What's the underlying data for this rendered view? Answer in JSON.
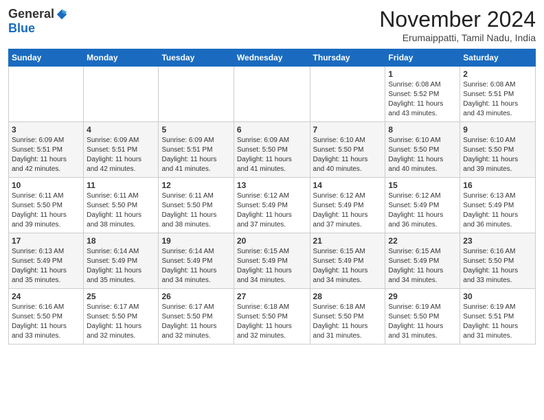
{
  "header": {
    "logo_general": "General",
    "logo_blue": "Blue",
    "month_title": "November 2024",
    "location": "Erumaippatti, Tamil Nadu, India"
  },
  "calendar": {
    "days_of_week": [
      "Sunday",
      "Monday",
      "Tuesday",
      "Wednesday",
      "Thursday",
      "Friday",
      "Saturday"
    ],
    "weeks": [
      [
        {
          "day": "",
          "info": ""
        },
        {
          "day": "",
          "info": ""
        },
        {
          "day": "",
          "info": ""
        },
        {
          "day": "",
          "info": ""
        },
        {
          "day": "",
          "info": ""
        },
        {
          "day": "1",
          "info": "Sunrise: 6:08 AM\nSunset: 5:52 PM\nDaylight: 11 hours\nand 43 minutes."
        },
        {
          "day": "2",
          "info": "Sunrise: 6:08 AM\nSunset: 5:51 PM\nDaylight: 11 hours\nand 43 minutes."
        }
      ],
      [
        {
          "day": "3",
          "info": "Sunrise: 6:09 AM\nSunset: 5:51 PM\nDaylight: 11 hours\nand 42 minutes."
        },
        {
          "day": "4",
          "info": "Sunrise: 6:09 AM\nSunset: 5:51 PM\nDaylight: 11 hours\nand 42 minutes."
        },
        {
          "day": "5",
          "info": "Sunrise: 6:09 AM\nSunset: 5:51 PM\nDaylight: 11 hours\nand 41 minutes."
        },
        {
          "day": "6",
          "info": "Sunrise: 6:09 AM\nSunset: 5:50 PM\nDaylight: 11 hours\nand 41 minutes."
        },
        {
          "day": "7",
          "info": "Sunrise: 6:10 AM\nSunset: 5:50 PM\nDaylight: 11 hours\nand 40 minutes."
        },
        {
          "day": "8",
          "info": "Sunrise: 6:10 AM\nSunset: 5:50 PM\nDaylight: 11 hours\nand 40 minutes."
        },
        {
          "day": "9",
          "info": "Sunrise: 6:10 AM\nSunset: 5:50 PM\nDaylight: 11 hours\nand 39 minutes."
        }
      ],
      [
        {
          "day": "10",
          "info": "Sunrise: 6:11 AM\nSunset: 5:50 PM\nDaylight: 11 hours\nand 39 minutes."
        },
        {
          "day": "11",
          "info": "Sunrise: 6:11 AM\nSunset: 5:50 PM\nDaylight: 11 hours\nand 38 minutes."
        },
        {
          "day": "12",
          "info": "Sunrise: 6:11 AM\nSunset: 5:50 PM\nDaylight: 11 hours\nand 38 minutes."
        },
        {
          "day": "13",
          "info": "Sunrise: 6:12 AM\nSunset: 5:49 PM\nDaylight: 11 hours\nand 37 minutes."
        },
        {
          "day": "14",
          "info": "Sunrise: 6:12 AM\nSunset: 5:49 PM\nDaylight: 11 hours\nand 37 minutes."
        },
        {
          "day": "15",
          "info": "Sunrise: 6:12 AM\nSunset: 5:49 PM\nDaylight: 11 hours\nand 36 minutes."
        },
        {
          "day": "16",
          "info": "Sunrise: 6:13 AM\nSunset: 5:49 PM\nDaylight: 11 hours\nand 36 minutes."
        }
      ],
      [
        {
          "day": "17",
          "info": "Sunrise: 6:13 AM\nSunset: 5:49 PM\nDaylight: 11 hours\nand 35 minutes."
        },
        {
          "day": "18",
          "info": "Sunrise: 6:14 AM\nSunset: 5:49 PM\nDaylight: 11 hours\nand 35 minutes."
        },
        {
          "day": "19",
          "info": "Sunrise: 6:14 AM\nSunset: 5:49 PM\nDaylight: 11 hours\nand 34 minutes."
        },
        {
          "day": "20",
          "info": "Sunrise: 6:15 AM\nSunset: 5:49 PM\nDaylight: 11 hours\nand 34 minutes."
        },
        {
          "day": "21",
          "info": "Sunrise: 6:15 AM\nSunset: 5:49 PM\nDaylight: 11 hours\nand 34 minutes."
        },
        {
          "day": "22",
          "info": "Sunrise: 6:15 AM\nSunset: 5:49 PM\nDaylight: 11 hours\nand 34 minutes."
        },
        {
          "day": "23",
          "info": "Sunrise: 6:16 AM\nSunset: 5:50 PM\nDaylight: 11 hours\nand 33 minutes."
        }
      ],
      [
        {
          "day": "24",
          "info": "Sunrise: 6:16 AM\nSunset: 5:50 PM\nDaylight: 11 hours\nand 33 minutes."
        },
        {
          "day": "25",
          "info": "Sunrise: 6:17 AM\nSunset: 5:50 PM\nDaylight: 11 hours\nand 32 minutes."
        },
        {
          "day": "26",
          "info": "Sunrise: 6:17 AM\nSunset: 5:50 PM\nDaylight: 11 hours\nand 32 minutes."
        },
        {
          "day": "27",
          "info": "Sunrise: 6:18 AM\nSunset: 5:50 PM\nDaylight: 11 hours\nand 32 minutes."
        },
        {
          "day": "28",
          "info": "Sunrise: 6:18 AM\nSunset: 5:50 PM\nDaylight: 11 hours\nand 31 minutes."
        },
        {
          "day": "29",
          "info": "Sunrise: 6:19 AM\nSunset: 5:50 PM\nDaylight: 11 hours\nand 31 minutes."
        },
        {
          "day": "30",
          "info": "Sunrise: 6:19 AM\nSunset: 5:51 PM\nDaylight: 11 hours\nand 31 minutes."
        }
      ]
    ]
  }
}
